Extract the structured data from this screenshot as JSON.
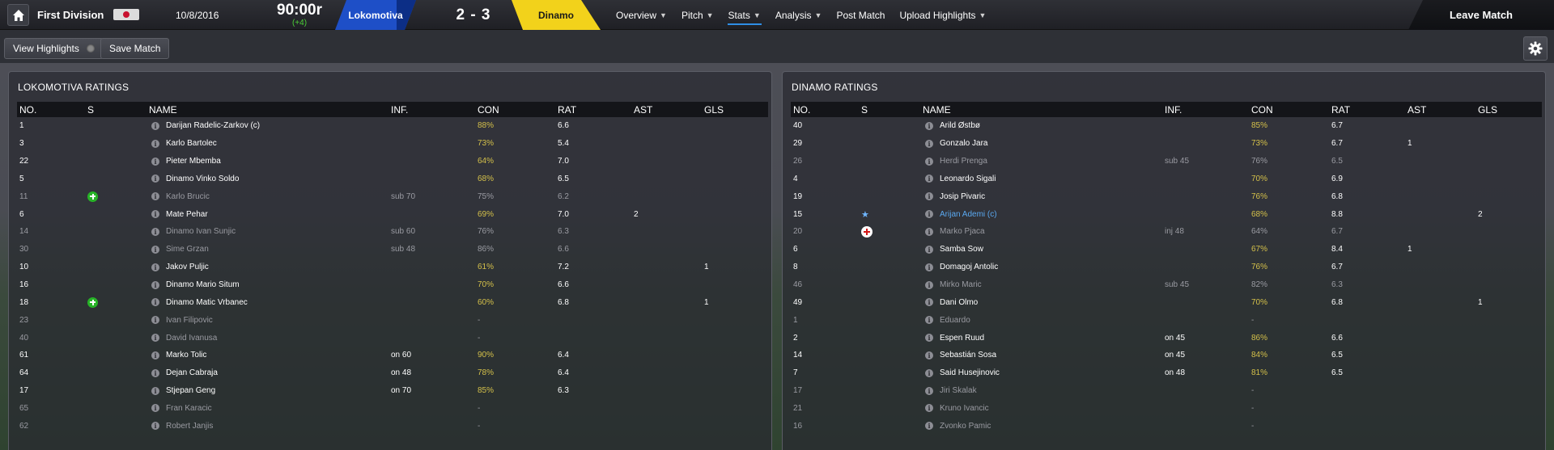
{
  "header": {
    "competition": "First Division",
    "date": "10/8/2016",
    "clock": "90:00r",
    "added_time": "(+4)",
    "home_team": "Lokomotiva",
    "score": "2 - 3",
    "away_team": "Dinamo",
    "nav": [
      {
        "label": "Overview",
        "dropdown": true,
        "active": false
      },
      {
        "label": "Pitch",
        "dropdown": true,
        "active": false
      },
      {
        "label": "Stats",
        "dropdown": true,
        "active": true
      },
      {
        "label": "Analysis",
        "dropdown": true,
        "active": false
      },
      {
        "label": "Post Match",
        "dropdown": false,
        "active": false
      },
      {
        "label": "Upload Highlights",
        "dropdown": true,
        "active": false
      }
    ],
    "leave_label": "Leave Match"
  },
  "toolbar": {
    "view_highlights": "View Highlights",
    "save_match": "Save Match"
  },
  "colors": {
    "home": "#1e4fc7",
    "away": "#f2d21b",
    "rating": "#33d13a",
    "condition": "#d4c04a",
    "link": "#5aa8ef"
  },
  "columns": [
    "NO.",
    "S",
    "NAME",
    "INF.",
    "CON",
    "RAT",
    "AST",
    "GLS"
  ],
  "left_panel": {
    "title": "LOKOMOTIVA RATINGS",
    "rows": [
      {
        "no": "1",
        "s": "",
        "name": "Darijan Radelic-Zarkov (c)",
        "inf": "",
        "con": "88%",
        "rat": "6.6",
        "ast": "",
        "gls": "",
        "unused": false
      },
      {
        "no": "3",
        "s": "",
        "name": "Karlo Bartolec",
        "inf": "",
        "con": "73%",
        "rat": "5.4",
        "ast": "",
        "gls": "",
        "unused": false
      },
      {
        "no": "22",
        "s": "",
        "name": "Pieter Mbemba",
        "inf": "",
        "con": "64%",
        "rat": "7.0",
        "ast": "",
        "gls": "",
        "unused": false
      },
      {
        "no": "5",
        "s": "",
        "name": "Dinamo Vinko Soldo",
        "inf": "",
        "con": "68%",
        "rat": "6.5",
        "ast": "",
        "gls": "",
        "unused": false
      },
      {
        "no": "11",
        "s": "sub-on",
        "name": "Karlo Brucic",
        "inf": "sub 70",
        "con": "75%",
        "rat": "6.2",
        "ast": "",
        "gls": "",
        "unused": true
      },
      {
        "no": "6",
        "s": "",
        "name": "Mate Pehar",
        "inf": "",
        "con": "69%",
        "rat": "7.0",
        "ast": "2",
        "gls": "",
        "unused": false
      },
      {
        "no": "14",
        "s": "",
        "name": "Dinamo Ivan Sunjic",
        "inf": "sub 60",
        "con": "76%",
        "rat": "6.3",
        "ast": "",
        "gls": "",
        "unused": true
      },
      {
        "no": "30",
        "s": "",
        "name": "Sime Grzan",
        "inf": "sub 48",
        "con": "86%",
        "rat": "6.6",
        "ast": "",
        "gls": "",
        "unused": true
      },
      {
        "no": "10",
        "s": "",
        "name": "Jakov Puljic",
        "inf": "",
        "con": "61%",
        "rat": "7.2",
        "ast": "",
        "gls": "1",
        "unused": false
      },
      {
        "no": "16",
        "s": "",
        "name": "Dinamo Mario Situm",
        "inf": "",
        "con": "70%",
        "rat": "6.6",
        "ast": "",
        "gls": "",
        "unused": false
      },
      {
        "no": "18",
        "s": "sub-on",
        "name": "Dinamo Matic Vrbanec",
        "inf": "",
        "con": "60%",
        "rat": "6.8",
        "ast": "",
        "gls": "1",
        "unused": false
      },
      {
        "no": "23",
        "s": "",
        "name": "Ivan Filipovic",
        "inf": "",
        "con": "-",
        "rat": "",
        "ast": "",
        "gls": "",
        "unused": true
      },
      {
        "no": "40",
        "s": "",
        "name": "David Ivanusa",
        "inf": "",
        "con": "-",
        "rat": "",
        "ast": "",
        "gls": "",
        "unused": true
      },
      {
        "no": "61",
        "s": "",
        "name": "Marko Tolic",
        "inf": "on 60",
        "con": "90%",
        "rat": "6.4",
        "ast": "",
        "gls": "",
        "unused": false
      },
      {
        "no": "64",
        "s": "",
        "name": "Dejan Cabraja",
        "inf": "on 48",
        "con": "78%",
        "rat": "6.4",
        "ast": "",
        "gls": "",
        "unused": false
      },
      {
        "no": "17",
        "s": "",
        "name": "Stjepan Geng",
        "inf": "on 70",
        "con": "85%",
        "rat": "6.3",
        "ast": "",
        "gls": "",
        "unused": false
      },
      {
        "no": "65",
        "s": "",
        "name": "Fran Karacic",
        "inf": "",
        "con": "-",
        "rat": "",
        "ast": "",
        "gls": "",
        "unused": true
      },
      {
        "no": "62",
        "s": "",
        "name": "Robert Janjis",
        "inf": "",
        "con": "-",
        "rat": "",
        "ast": "",
        "gls": "",
        "unused": true
      }
    ]
  },
  "right_panel": {
    "title": "DINAMO RATINGS",
    "rows": [
      {
        "no": "40",
        "s": "",
        "name": "Arild Østbø",
        "inf": "",
        "con": "85%",
        "rat": "6.7",
        "ast": "",
        "gls": "",
        "unused": false
      },
      {
        "no": "29",
        "s": "",
        "name": "Gonzalo Jara",
        "inf": "",
        "con": "73%",
        "rat": "6.7",
        "ast": "1",
        "gls": "",
        "unused": false
      },
      {
        "no": "26",
        "s": "",
        "name": "Herdi Prenga",
        "inf": "sub 45",
        "con": "76%",
        "rat": "6.5",
        "ast": "",
        "gls": "",
        "unused": true
      },
      {
        "no": "4",
        "s": "",
        "name": "Leonardo Sigali",
        "inf": "",
        "con": "70%",
        "rat": "6.9",
        "ast": "",
        "gls": "",
        "unused": false
      },
      {
        "no": "19",
        "s": "",
        "name": "Josip Pivaric",
        "inf": "",
        "con": "76%",
        "rat": "6.8",
        "ast": "",
        "gls": "",
        "unused": false
      },
      {
        "no": "15",
        "s": "star",
        "name": "Arijan Ademi (c)",
        "inf": "",
        "con": "68%",
        "rat": "8.8",
        "ast": "",
        "gls": "2",
        "unused": false,
        "highlight": true
      },
      {
        "no": "20",
        "s": "injury",
        "name": "Marko Pjaca",
        "inf": "inj 48",
        "con": "64%",
        "rat": "6.7",
        "ast": "",
        "gls": "",
        "unused": true
      },
      {
        "no": "6",
        "s": "",
        "name": "Samba Sow",
        "inf": "",
        "con": "67%",
        "rat": "8.4",
        "ast": "1",
        "gls": "",
        "unused": false
      },
      {
        "no": "8",
        "s": "",
        "name": "Domagoj Antolic",
        "inf": "",
        "con": "76%",
        "rat": "6.7",
        "ast": "",
        "gls": "",
        "unused": false
      },
      {
        "no": "46",
        "s": "",
        "name": "Mirko Maric",
        "inf": "sub 45",
        "con": "82%",
        "rat": "6.3",
        "ast": "",
        "gls": "",
        "unused": true
      },
      {
        "no": "49",
        "s": "",
        "name": "Dani Olmo",
        "inf": "",
        "con": "70%",
        "rat": "6.8",
        "ast": "",
        "gls": "1",
        "unused": false
      },
      {
        "no": "1",
        "s": "",
        "name": "Eduardo",
        "inf": "",
        "con": "-",
        "rat": "",
        "ast": "",
        "gls": "",
        "unused": true
      },
      {
        "no": "2",
        "s": "",
        "name": "Espen Ruud",
        "inf": "on 45",
        "con": "86%",
        "rat": "6.6",
        "ast": "",
        "gls": "",
        "unused": false
      },
      {
        "no": "14",
        "s": "",
        "name": "Sebastián Sosa",
        "inf": "on 45",
        "con": "84%",
        "rat": "6.5",
        "ast": "",
        "gls": "",
        "unused": false
      },
      {
        "no": "7",
        "s": "",
        "name": "Said Husejinovic",
        "inf": "on 48",
        "con": "81%",
        "rat": "6.5",
        "ast": "",
        "gls": "",
        "unused": false
      },
      {
        "no": "17",
        "s": "",
        "name": "Jiri Skalak",
        "inf": "",
        "con": "-",
        "rat": "",
        "ast": "",
        "gls": "",
        "unused": true
      },
      {
        "no": "21",
        "s": "",
        "name": "Kruno Ivancic",
        "inf": "",
        "con": "-",
        "rat": "",
        "ast": "",
        "gls": "",
        "unused": true
      },
      {
        "no": "16",
        "s": "",
        "name": "Zvonko Pamic",
        "inf": "",
        "con": "-",
        "rat": "",
        "ast": "",
        "gls": "",
        "unused": true
      }
    ]
  }
}
